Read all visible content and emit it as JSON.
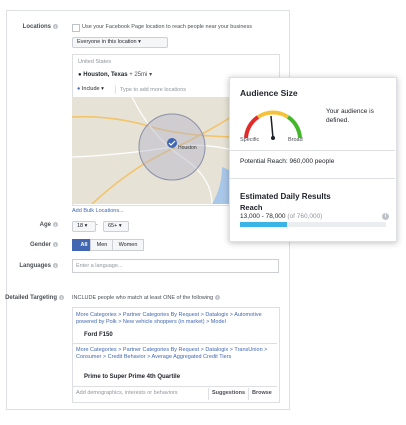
{
  "locations": {
    "label": "Locations",
    "facebook_page_checkbox": "Use your Facebook Page location to reach people near your business",
    "location_type": "Everyone in this location",
    "country": "United States",
    "city": "Houston, Texas",
    "radius": "+ 25mi",
    "include": "Include",
    "add_placeholder": "Type to add more locations",
    "add_bulk": "Add Bulk Locations...",
    "map_label": "Houston"
  },
  "age": {
    "label": "Age",
    "min": "18",
    "max": "65+",
    "separator": "-"
  },
  "gender": {
    "label": "Gender",
    "options": [
      "All",
      "Men",
      "Women"
    ]
  },
  "languages": {
    "label": "Languages",
    "placeholder": "Enter a language..."
  },
  "targeting": {
    "label": "Detailed Targeting",
    "heading": "INCLUDE people who match at least ONE of the following",
    "group1_path": "More Categories > Partner Categories By Request > Datalogix > Automotive powered by Polk > New vehicle shoppers (in market) > Model",
    "group1_value": "Ford F150",
    "group2_path": "More Categories > Partner Categories By Request > Datalogix > TransUnion > Consumer > Credit Behavior > Average Aggregated Credit Tiers",
    "group2_value": "Prime to Super Prime 4th Quartile",
    "add_placeholder": "Add demographics, interests or behaviors",
    "suggestions": "Suggestions",
    "browse": "Browse"
  },
  "audience": {
    "title": "Audience Size",
    "gauge_left": "Specific",
    "gauge_right": "Broad",
    "status": "Your audience is defined.",
    "reach": "Potential Reach: 960,000 people"
  },
  "results": {
    "title": "Estimated Daily Results",
    "subtitle": "Reach",
    "range": "13,000 - 78,000",
    "of_total": "(of 760,000)",
    "bar_fill_fraction": 0.32
  },
  "colors": {
    "accent": "#4267b2",
    "bar": "#3ab4e6",
    "gauge_red": "#e02b2b",
    "gauge_green": "#42b72a"
  }
}
